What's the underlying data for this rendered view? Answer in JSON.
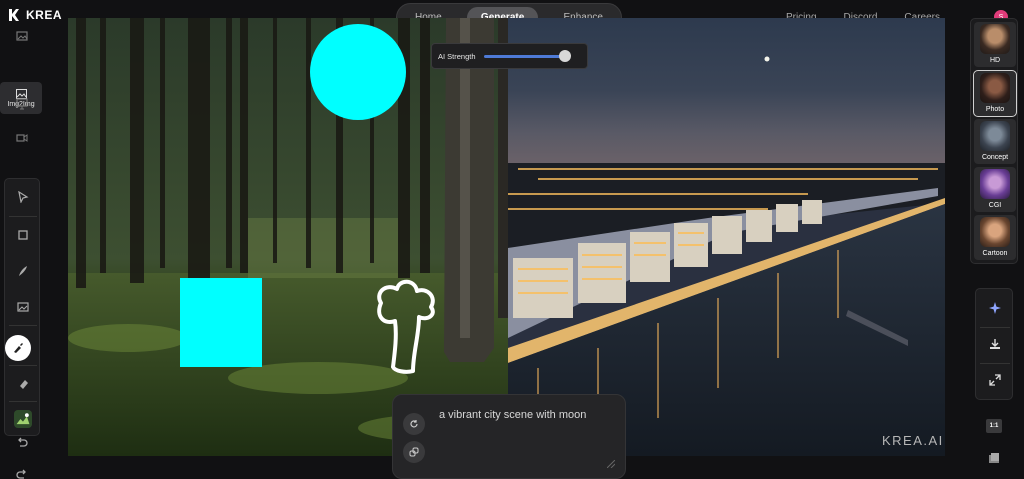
{
  "app": {
    "name": "KREA",
    "watermark": "KREA.AI"
  },
  "topnav": {
    "tabs": [
      {
        "label": "Home",
        "active": false
      },
      {
        "label": "Generate",
        "active": true
      },
      {
        "label": "Enhance",
        "active": false
      }
    ]
  },
  "rightnav": {
    "links": [
      "Pricing",
      "Discord",
      "Careers"
    ],
    "avatar_initial": "S"
  },
  "left_toolbar": {
    "img2img_label": "Img2Img"
  },
  "strength": {
    "label": "AI Strength",
    "value": 0.95
  },
  "prompt": {
    "text": "a vibrant city scene with moon"
  },
  "styles": [
    {
      "label": "HD",
      "active": false
    },
    {
      "label": "Photo",
      "active": true
    },
    {
      "label": "Concept",
      "active": false
    },
    {
      "label": "CGI",
      "active": false
    },
    {
      "label": "Cartoon",
      "active": false
    }
  ],
  "ratio_label": "1:1",
  "colors": {
    "accent": "#4e7ad6",
    "shape": "#00ffff",
    "bg": "#111113"
  }
}
